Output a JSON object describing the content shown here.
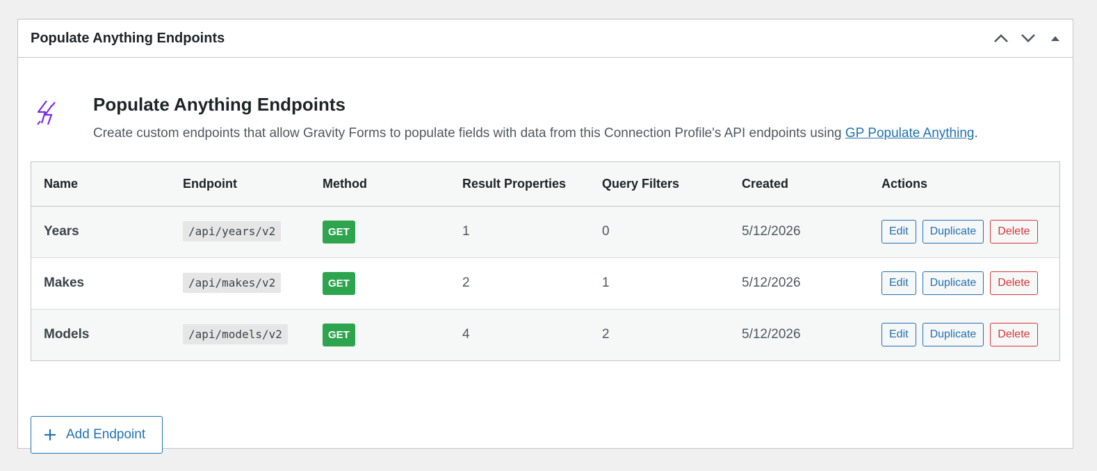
{
  "panel": {
    "title": "Populate Anything Endpoints",
    "controls": [
      "chevron-up-icon",
      "chevron-down-icon",
      "triangle-up-icon"
    ]
  },
  "intro": {
    "icon": "lightning-bolt-icon",
    "icon_color": "#7a2ae2",
    "title": "Populate Anything Endpoints",
    "desc_prefix": "Create custom endpoints that allow Gravity Forms to populate fields with data from this Connection Profile's API endpoints using ",
    "link_text": "GP Populate Anything",
    "desc_suffix": "."
  },
  "table": {
    "headers": {
      "name": "Name",
      "endpoint": "Endpoint",
      "method": "Method",
      "result_properties": "Result Properties",
      "query_filters": "Query Filters",
      "created": "Created",
      "actions": "Actions"
    },
    "rows": [
      {
        "name": "Years",
        "endpoint": "/api/years/v2",
        "method": "GET",
        "result_properties": "1",
        "query_filters": "0",
        "created": "5/12/2026"
      },
      {
        "name": "Makes",
        "endpoint": "/api/makes/v2",
        "method": "GET",
        "result_properties": "2",
        "query_filters": "1",
        "created": "5/12/2026"
      },
      {
        "name": "Models",
        "endpoint": "/api/models/v2",
        "method": "GET",
        "result_properties": "4",
        "query_filters": "2",
        "created": "5/12/2026"
      }
    ],
    "actions": {
      "edit": "Edit",
      "duplicate": "Duplicate",
      "delete": "Delete"
    }
  },
  "add_button": {
    "label": "Add Endpoint",
    "icon": "plus-icon"
  },
  "colors": {
    "accent": "#2271b1",
    "delete": "#d63638",
    "method_get": "#2ea44f",
    "icon": "#7a2ae2"
  }
}
